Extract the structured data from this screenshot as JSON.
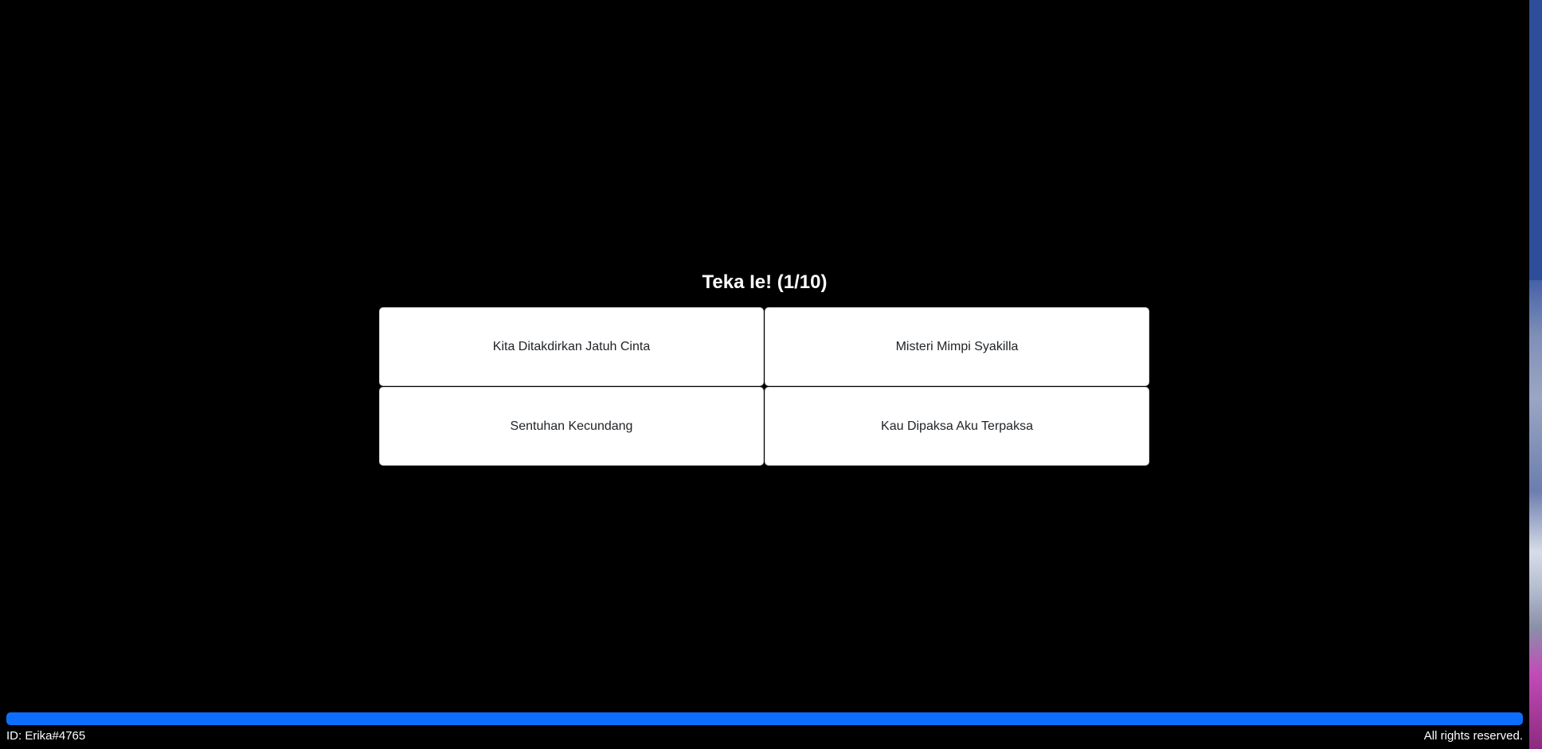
{
  "quiz": {
    "title": "Teka Ie! (1/10)",
    "options": [
      "Kita Ditakdirkan Jatuh Cinta",
      "Misteri Mimpi Syakilla",
      "Sentuhan Kecundang",
      "Kau Dipaksa Aku Terpaksa"
    ]
  },
  "progress": {
    "fraction": 1.0
  },
  "footer": {
    "player_id": "ID: Erika#4765",
    "rights": "All rights reserved."
  },
  "colors": {
    "background": "#000000",
    "progress_bar": "#0d6efd",
    "option_background": "#ffffff"
  }
}
